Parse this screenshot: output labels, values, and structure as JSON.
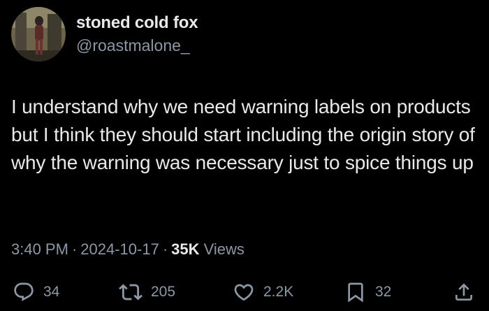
{
  "tweet": {
    "author": {
      "display_name": "stoned cold fox",
      "handle": "@roastmalone_"
    },
    "text": "I understand why we need warning labels on products but I think they should start including the origin story of why the warning was necessary just to spice things up",
    "meta": {
      "time": "3:40 PM",
      "date": "2024-10-17",
      "separator": "·",
      "views_count": "35K",
      "views_label": "Views"
    },
    "actions": {
      "replies": "34",
      "reposts": "205",
      "likes": "2.2K",
      "bookmarks": "32"
    }
  },
  "colors": {
    "background": "#000000",
    "primary_text": "#e7e9ea",
    "secondary_text": "#8b98a5"
  },
  "icons": [
    "reply-icon",
    "repost-icon",
    "like-icon",
    "bookmark-icon",
    "share-icon"
  ]
}
